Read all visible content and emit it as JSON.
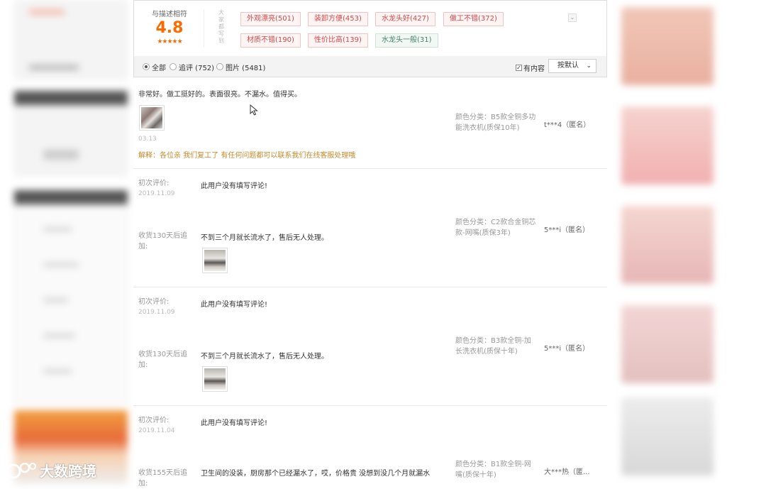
{
  "summary": {
    "score_label": "与描述相符",
    "score_value": "4.8",
    "stars": "★★★★★",
    "vertical_caption": "大家都写到",
    "tags": [
      {
        "label": "外观漂亮(501)",
        "sentiment": "positive"
      },
      {
        "label": "装卸方便(453)",
        "sentiment": "positive"
      },
      {
        "label": "水龙头好(427)",
        "sentiment": "positive"
      },
      {
        "label": "做工不错(372)",
        "sentiment": "positive"
      },
      {
        "label": "材质不错(190)",
        "sentiment": "positive"
      },
      {
        "label": "性价比高(139)",
        "sentiment": "positive"
      },
      {
        "label": "水龙头一般(31)",
        "sentiment": "neutral"
      }
    ],
    "collapse_icon": "chevron-down-icon"
  },
  "filters": {
    "all": "全部",
    "followup": "追评 (752)",
    "images": "图片 (5481)",
    "has_content": "有内容",
    "has_content_checked": true,
    "sort": "按默认"
  },
  "reviews": [
    {
      "text": "非常好。做工挺好的。表面很亮。不漏水。值得买。",
      "date": "03.13",
      "reply": "解释：各位亲 我们复工了 有任何问题都可以联系我们在线客服处理哦",
      "sku": "颜色分类：B5款全铜多功能洗衣机(质保10年)",
      "user": "t***4（匿名）"
    },
    {
      "initial_label": "初次评价:",
      "initial_date": "2019.11.09",
      "initial_text": "此用户没有填写评论!",
      "followup_label": "收货130天后追加:",
      "followup_text": "不到三个月就长流水了，售后无人处理。",
      "sku": "颜色分类：C2款合金铜芯款-网嘴(质保3年)",
      "user": "5***i（匿名）"
    },
    {
      "initial_label": "初次评价:",
      "initial_date": "2019.11.09",
      "initial_text": "此用户没有填写评论!",
      "followup_label": "收货130天后追加:",
      "followup_text": "不到三个月就长流水了，售后无人处理。",
      "sku": "颜色分类：B3款全铜-加长洗衣机(质保十年)",
      "user": "5***i（匿名）"
    },
    {
      "initial_label": "初次评价:",
      "initial_date": "2019.11.04",
      "initial_text": "此用户没有填写评论!",
      "followup_label": "收货155天后追加:",
      "followup_text": "卫生间的没装，厨房那个已经漏水了，哎，价格贵 没想到没几个月就漏水",
      "sku": "颜色分类：B1款全铜-网嘴(质保十年)",
      "user": "大***热（匿..."
    }
  ],
  "watermark": {
    "text": "大数跨境"
  }
}
